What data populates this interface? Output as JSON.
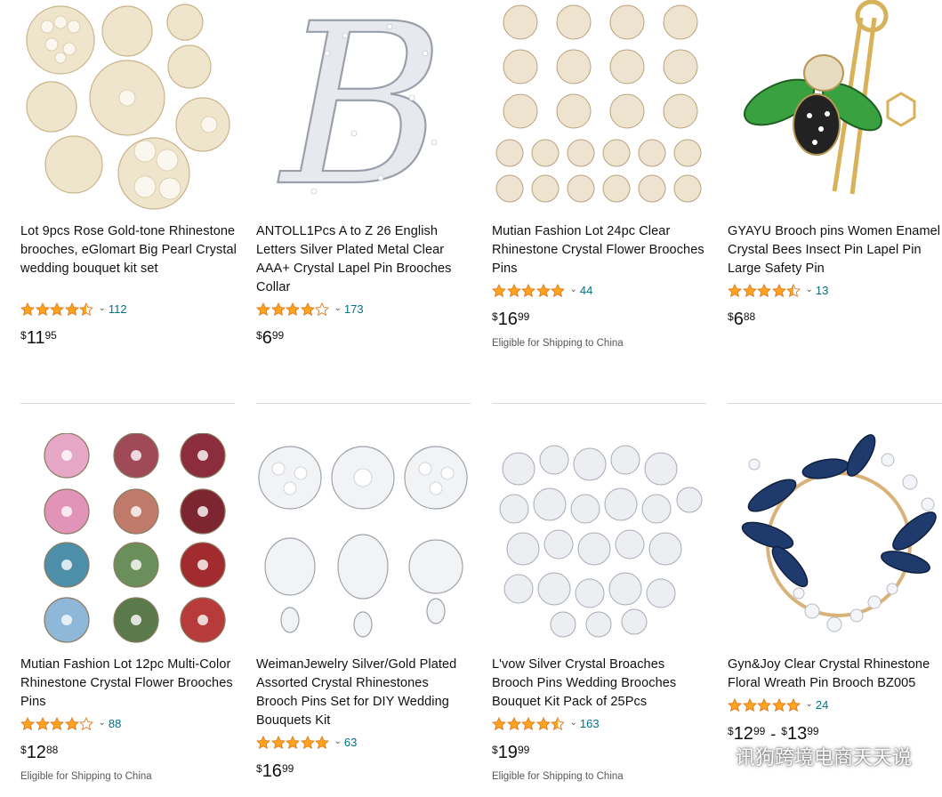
{
  "products": [
    {
      "title": "Lot 9pcs Rose Gold-tone Rhinestone brooches, eGlomart Big Pearl Crystal wedding bouquet kit set",
      "rating": 4.5,
      "count": "112",
      "price": {
        "sym": "$",
        "whole": "11",
        "frac": "95"
      },
      "ship": ""
    },
    {
      "title": "ANTOLL1Pcs A to Z 26 English Letters Silver Plated Metal Clear AAA+ Crystal Lapel Pin Brooches Collar",
      "rating": 4.0,
      "count": "173",
      "price": {
        "sym": "$",
        "whole": "6",
        "frac": "99"
      },
      "ship": ""
    },
    {
      "title": "Mutian Fashion Lot 24pc Clear Rhinestone Crystal Flower Brooches Pins",
      "rating": 5.0,
      "count": "44",
      "price": {
        "sym": "$",
        "whole": "16",
        "frac": "99"
      },
      "ship": "Eligible for Shipping to China"
    },
    {
      "title": "GYAYU Brooch pins Women Enamel Crystal Bees Insect Pin Lapel Pin Large Safety Pin",
      "rating": 4.5,
      "count": "13",
      "price": {
        "sym": "$",
        "whole": "6",
        "frac": "88"
      },
      "ship": ""
    },
    {
      "title": "Mutian Fashion Lot 12pc Multi-Color Rhinestone Crystal Flower Brooches Pins",
      "rating": 4.0,
      "count": "88",
      "price": {
        "sym": "$",
        "whole": "12",
        "frac": "88"
      },
      "ship": "Eligible for Shipping to China"
    },
    {
      "title": "WeimanJewelry Silver/Gold Plated Assorted Crystal Rhinestones Brooch Pins Set for DIY Wedding Bouquets Kit",
      "rating": 5.0,
      "count": "63",
      "price": {
        "sym": "$",
        "whole": "16",
        "frac": "99"
      },
      "ship": ""
    },
    {
      "title": "L'vow Silver Crystal Broaches Brooch Pins Wedding Brooches Bouquet Kit Pack of 25Pcs",
      "rating": 4.5,
      "count": "163",
      "price": {
        "sym": "$",
        "whole": "19",
        "frac": "99"
      },
      "ship": "Eligible for Shipping to China"
    },
    {
      "title": "Gyn&Joy Clear Crystal Rhinestone Floral Wreath Pin Brooch BZ005",
      "rating": 5.0,
      "count": "24",
      "price": {
        "sym": "$",
        "whole": "12",
        "frac": "99",
        "range_sym": "$",
        "range_whole": "13",
        "range_frac": "99"
      },
      "ship": ""
    }
  ],
  "colors": {
    "star": "#ffa41c",
    "link": "#007185",
    "divider": "#d5d9d9"
  },
  "icons": {
    "rating_expand": "chevron-down-icon",
    "star": "star-icon",
    "watermark": "wechat-icon"
  },
  "watermark": {
    "text": "讯狗跨境电商天天说"
  }
}
